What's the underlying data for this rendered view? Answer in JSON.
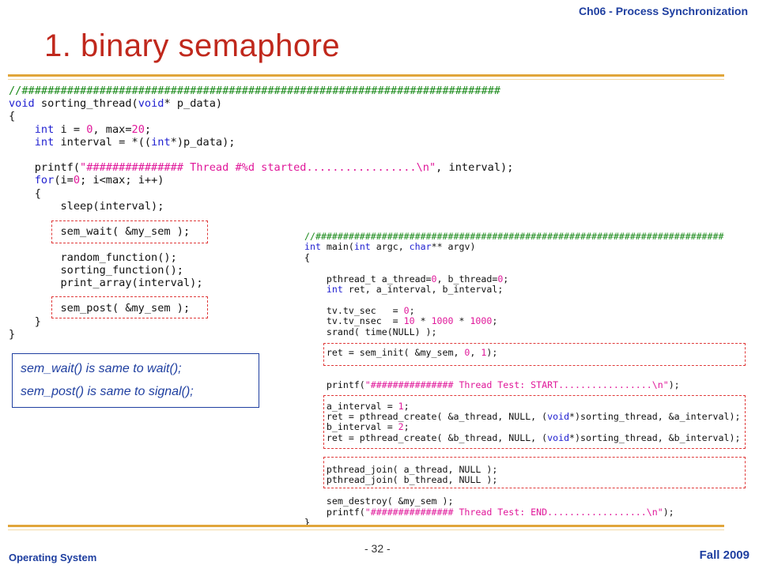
{
  "header": {
    "chapter": "Ch06 - Process Synchronization",
    "title": "1. binary semaphore"
  },
  "code_blocks": [
    {
      "lines": [
        [
          [
            "//##########################################################################",
            "comment"
          ]
        ],
        [
          [
            "void",
            "kw"
          ],
          [
            " sorting_thread(",
            "plain"
          ],
          [
            "void",
            "kw"
          ],
          [
            "* p_data)",
            "plain"
          ]
        ],
        [
          [
            "{",
            "plain"
          ]
        ],
        [
          [
            "    ",
            "plain"
          ],
          [
            "int",
            "kw"
          ],
          [
            " i = ",
            "plain"
          ],
          [
            "0",
            "num"
          ],
          [
            ", max=",
            "plain"
          ],
          [
            "20",
            "num"
          ],
          [
            ";",
            "plain"
          ]
        ],
        [
          [
            "    ",
            "plain"
          ],
          [
            "int",
            "kw"
          ],
          [
            " interval = *((",
            "plain"
          ],
          [
            "int",
            "kw"
          ],
          [
            "*)p_data);",
            "plain"
          ]
        ],
        [
          [
            "",
            "plain"
          ]
        ],
        [
          [
            "    printf(",
            "plain"
          ],
          [
            "\"############### Thread #%d started.................\\n\"",
            "str"
          ],
          [
            ", interval);",
            "plain"
          ]
        ],
        [
          [
            "    ",
            "plain"
          ],
          [
            "for",
            "kw"
          ],
          [
            "(i=",
            "plain"
          ],
          [
            "0",
            "num"
          ],
          [
            "; i<max; i++)",
            "plain"
          ]
        ],
        [
          [
            "    {",
            "plain"
          ]
        ],
        [
          [
            "        sleep(interval);",
            "plain"
          ]
        ],
        [
          [
            "",
            "plain"
          ]
        ],
        [
          [
            "        sem_wait( &my_sem );",
            "plain"
          ]
        ],
        [
          [
            "",
            "plain"
          ]
        ],
        [
          [
            "        random_function();",
            "plain"
          ]
        ],
        [
          [
            "        sorting_function();",
            "plain"
          ]
        ],
        [
          [
            "        print_array(interval);",
            "plain"
          ]
        ],
        [
          [
            "",
            "plain"
          ]
        ],
        [
          [
            "        sem_post( &my_sem );",
            "plain"
          ]
        ],
        [
          [
            "    }",
            "plain"
          ]
        ],
        [
          [
            "}",
            "plain"
          ]
        ]
      ]
    },
    {
      "lines": [
        [
          [
            "//##########################################################################",
            "comment"
          ]
        ],
        [
          [
            "int",
            "kw"
          ],
          [
            " main(",
            "plain"
          ],
          [
            "int",
            "kw"
          ],
          [
            " argc, ",
            "plain"
          ],
          [
            "char",
            "kw"
          ],
          [
            "** argv)",
            "plain"
          ]
        ],
        [
          [
            "{",
            "plain"
          ]
        ],
        [
          [
            "",
            "plain"
          ]
        ],
        [
          [
            "    pthread_t a_thread=",
            "plain"
          ],
          [
            "0",
            "num"
          ],
          [
            ", b_thread=",
            "plain"
          ],
          [
            "0",
            "num"
          ],
          [
            ";",
            "plain"
          ]
        ],
        [
          [
            "    ",
            "plain"
          ],
          [
            "int",
            "kw"
          ],
          [
            " ret, a_interval, b_interval;",
            "plain"
          ]
        ],
        [
          [
            "",
            "plain"
          ]
        ],
        [
          [
            "    tv.tv_sec   = ",
            "plain"
          ],
          [
            "0",
            "num"
          ],
          [
            ";",
            "plain"
          ]
        ],
        [
          [
            "    tv.tv_nsec  = ",
            "plain"
          ],
          [
            "10",
            "num"
          ],
          [
            " * ",
            "plain"
          ],
          [
            "1000",
            "num"
          ],
          [
            " * ",
            "plain"
          ],
          [
            "1000",
            "num"
          ],
          [
            ";",
            "plain"
          ]
        ],
        [
          [
            "    srand( time(NULL) );",
            "plain"
          ]
        ],
        [
          [
            "",
            "plain"
          ]
        ],
        [
          [
            "    ret = sem_init( &my_sem, ",
            "plain"
          ],
          [
            "0",
            "num"
          ],
          [
            ", ",
            "plain"
          ],
          [
            "1",
            "num"
          ],
          [
            ");",
            "plain"
          ]
        ],
        [
          [
            "",
            "plain"
          ]
        ],
        [
          [
            "",
            "plain"
          ]
        ],
        [
          [
            "    printf(",
            "plain"
          ],
          [
            "\"############### Thread Test: START.................\\n\"",
            "str"
          ],
          [
            ");",
            "plain"
          ]
        ],
        [
          [
            "",
            "plain"
          ]
        ],
        [
          [
            "    a_interval = ",
            "plain"
          ],
          [
            "1",
            "num"
          ],
          [
            ";",
            "plain"
          ]
        ],
        [
          [
            "    ret = pthread_create( &a_thread, NULL, (",
            "plain"
          ],
          [
            "void",
            "kw"
          ],
          [
            "*)sorting_thread, &a_interval);",
            "plain"
          ]
        ],
        [
          [
            "    b_interval = ",
            "plain"
          ],
          [
            "2",
            "num"
          ],
          [
            ";",
            "plain"
          ]
        ],
        [
          [
            "    ret = pthread_create( &b_thread, NULL, (",
            "plain"
          ],
          [
            "void",
            "kw"
          ],
          [
            "*)sorting_thread, &b_interval);",
            "plain"
          ]
        ],
        [
          [
            "",
            "plain"
          ]
        ],
        [
          [
            "",
            "plain"
          ]
        ],
        [
          [
            "    pthread_join( a_thread, NULL );",
            "plain"
          ]
        ],
        [
          [
            "    pthread_join( b_thread, NULL );",
            "plain"
          ]
        ],
        [
          [
            "",
            "plain"
          ]
        ],
        [
          [
            "    sem_destroy( &my_sem );",
            "plain"
          ]
        ],
        [
          [
            "    printf(",
            "plain"
          ],
          [
            "\"############### Thread Test: END..................\\n\"",
            "str"
          ],
          [
            ");",
            "plain"
          ]
        ],
        [
          [
            "}",
            "plain"
          ]
        ]
      ]
    }
  ],
  "token_colors": {
    "plain": "#111111",
    "kw": "#1f1fd0",
    "num": "#e0189a",
    "str": "#e0189a",
    "comment": "#1a8a1a"
  },
  "note": {
    "line1": "sem_wait() is same to wait();",
    "line2": "sem_post() is same to signal();"
  },
  "footer": {
    "left": "Operating System",
    "page": "- 32 -",
    "right": "Fall 2009"
  },
  "colors": {
    "title": "#c0281c",
    "accent_blue": "#1f3fa0",
    "rule": "#e0a53a",
    "dash": "#e03a3a"
  }
}
